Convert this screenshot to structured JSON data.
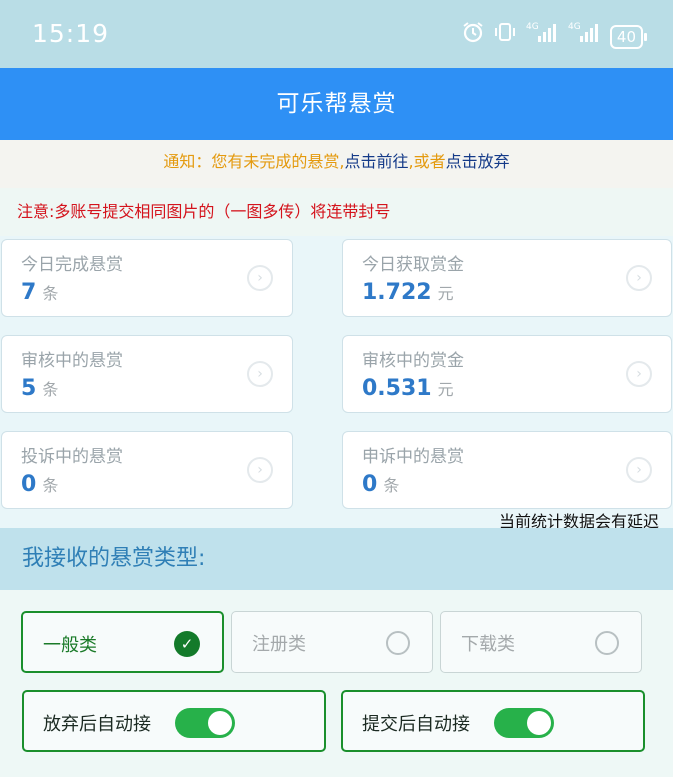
{
  "status_bar": {
    "time": "15:19",
    "icons": [
      "alarm-icon",
      "vibrate-icon",
      "signal-4g-icon",
      "signal-4g-icon"
    ],
    "signal_labels": [
      "4G",
      "4G"
    ],
    "battery": "40"
  },
  "header": {
    "title": "可乐帮悬赏"
  },
  "notice": {
    "prefix": "通知：您有未完成的悬赏,",
    "go_link": "点击前往",
    "separator": ",或者",
    "abandon_link": "点击放弃"
  },
  "warning": "注意:多账号提交相同图片的（一图多传）将连带封号",
  "stats": [
    {
      "label": "今日完成悬赏",
      "value": "7",
      "unit": "条"
    },
    {
      "label": "今日获取赏金",
      "value": "1.722",
      "unit": "元"
    },
    {
      "label": "审核中的悬赏",
      "value": "5",
      "unit": "条"
    },
    {
      "label": "审核中的赏金",
      "value": "0.531",
      "unit": "元"
    },
    {
      "label": "投诉中的悬赏",
      "value": "0",
      "unit": "条"
    },
    {
      "label": "申诉中的悬赏",
      "value": "0",
      "unit": "条"
    }
  ],
  "delay_note": "当前统计数据会有延迟",
  "section_title": "我接收的悬赏类型:",
  "types": [
    {
      "label": "一般类",
      "selected": true
    },
    {
      "label": "注册类",
      "selected": false
    },
    {
      "label": "下载类",
      "selected": false
    }
  ],
  "toggles": [
    {
      "label": "放弃后自动接",
      "on": true
    },
    {
      "label": "提交后自动接",
      "on": true
    }
  ],
  "colors": {
    "header_blue": "#2e90f5",
    "value_blue": "#2e79c8",
    "notice_orange": "#e49a0e",
    "notice_navy": "#143a88",
    "warning_red": "#d4131c",
    "toggle_green": "#27b14a",
    "selected_green": "#1a8f2c"
  }
}
